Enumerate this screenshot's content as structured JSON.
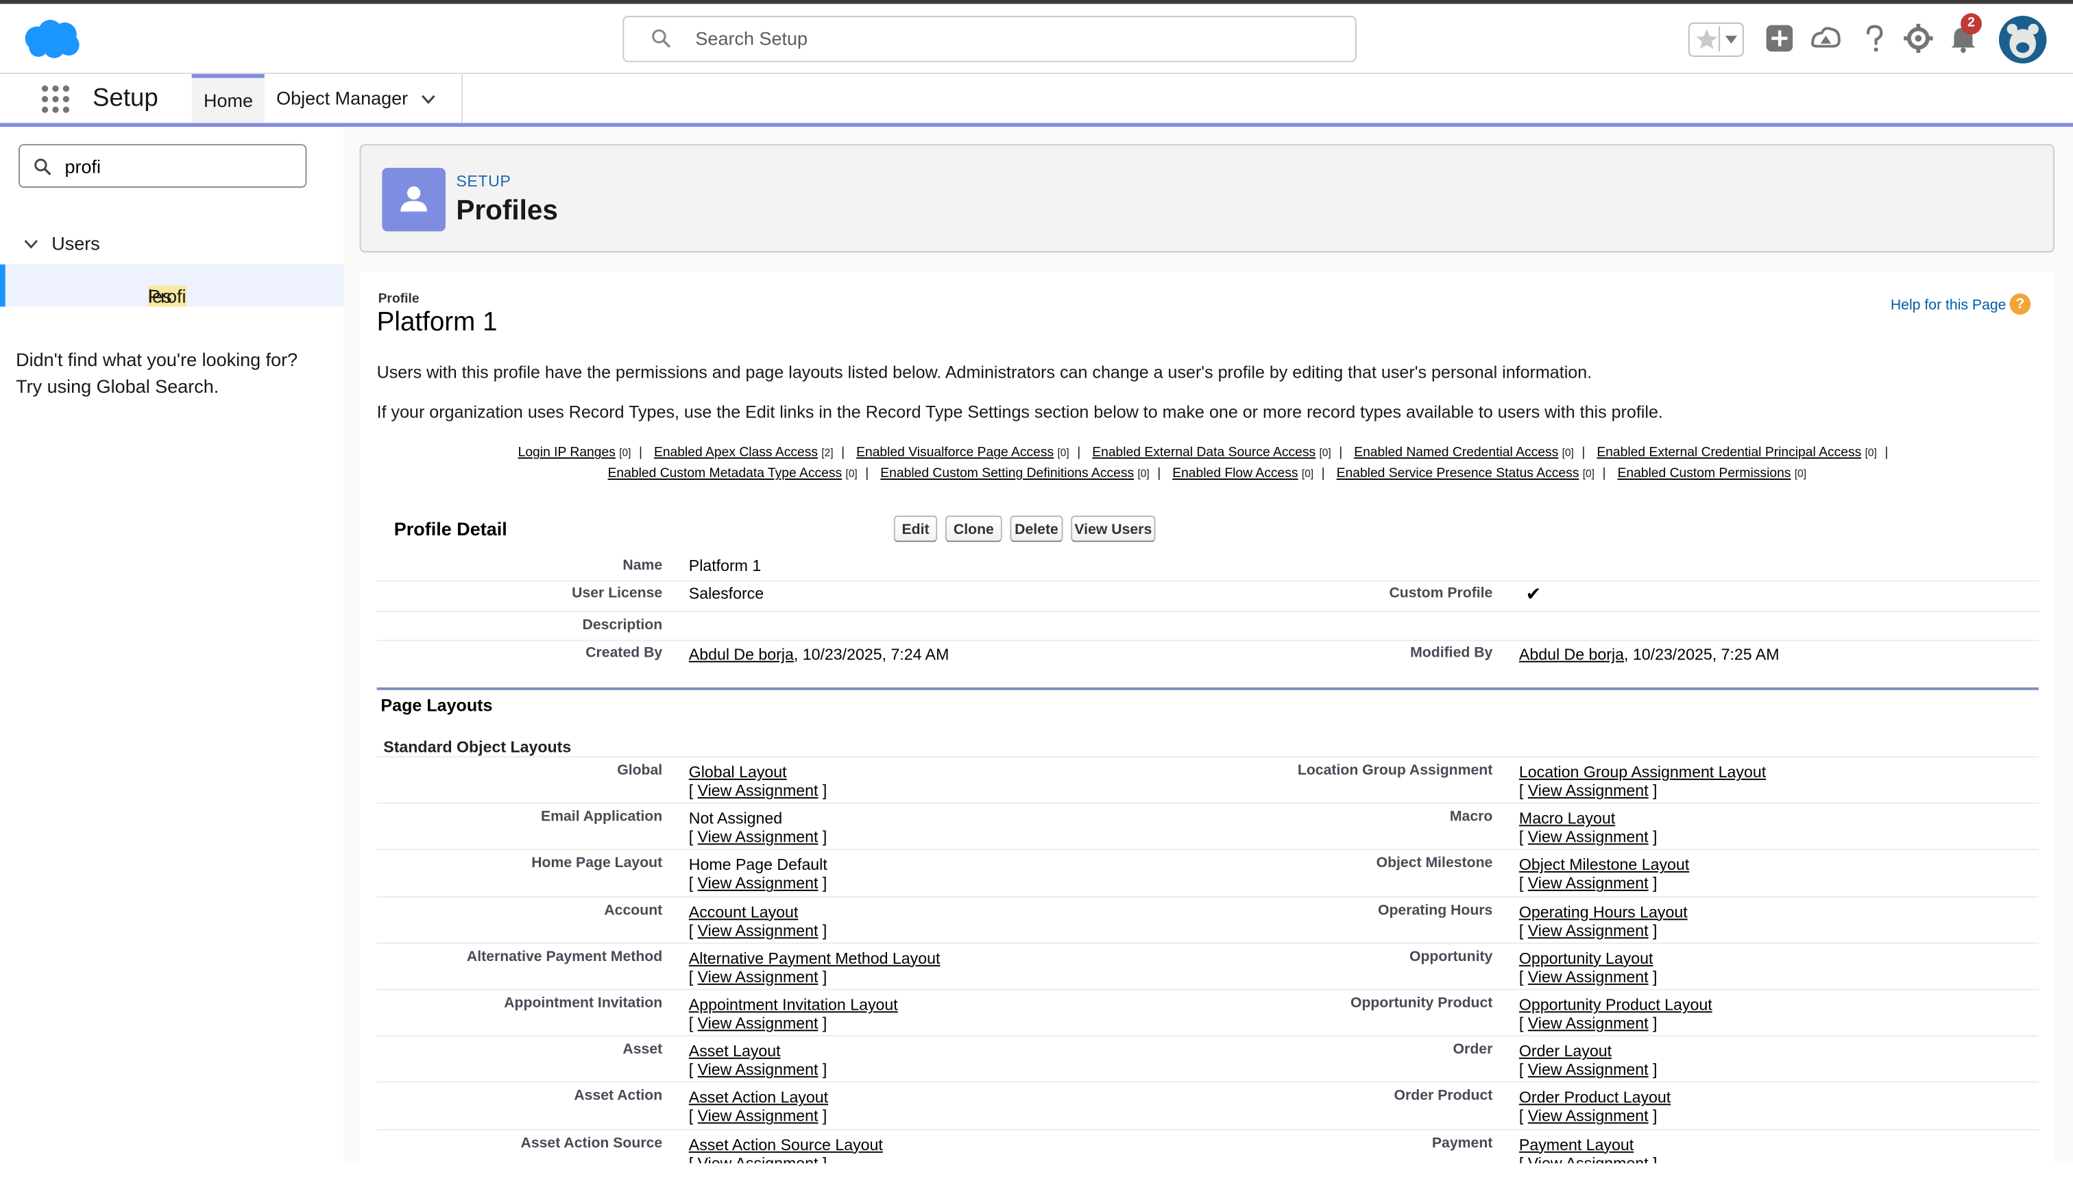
{
  "header": {
    "search_placeholder": "Search Setup",
    "notification_count": "2",
    "icons": [
      "favorites-star-icon",
      "add-icon",
      "trailhead-icon",
      "help-icon",
      "gear-icon",
      "bell-icon",
      "avatar"
    ]
  },
  "appnav": {
    "app_name": "Setup",
    "tab_home": "Home",
    "tab_object_manager": "Object Manager"
  },
  "sidebar": {
    "quickfind_value": "profi",
    "tree_parent": "Users",
    "tree_child_highlight": "Profi",
    "tree_child_rest": "les",
    "notfound_line1": "Didn't find what you're looking for?",
    "notfound_line2": "Try using Global Search."
  },
  "page_header": {
    "crumb": "SETUP",
    "title": "Profiles"
  },
  "profile": {
    "type_label": "Profile",
    "name": "Platform 1",
    "help_link": "Help for this Page",
    "help_icon": "?",
    "desc1": "Users with this profile have the permissions and page layouts listed below. Administrators can change a user's profile by editing that user's personal information.",
    "desc2": "If your organization uses Record Types, use the Edit links in the Record Type Settings section below to make one or more record types available to users with this profile.",
    "links_row1": [
      {
        "label": "Login IP Ranges",
        "count": "[0]"
      },
      {
        "label": "Enabled Apex Class Access",
        "count": "[2]"
      },
      {
        "label": "Enabled Visualforce Page Access",
        "count": "[0]"
      },
      {
        "label": "Enabled External Data Source Access",
        "count": "[0]"
      },
      {
        "label": "Enabled Named Credential Access",
        "count": "[0]"
      },
      {
        "label": "Enabled External Credential Principal Access",
        "count": "[0]"
      }
    ],
    "links_row2": [
      {
        "label": "Enabled Custom Metadata Type Access",
        "count": "[0]"
      },
      {
        "label": "Enabled Custom Setting Definitions Access",
        "count": "[0]"
      },
      {
        "label": "Enabled Flow Access",
        "count": "[0]"
      },
      {
        "label": "Enabled Service Presence Status Access",
        "count": "[0]"
      },
      {
        "label": "Enabled Custom Permissions",
        "count": "[0]"
      }
    ],
    "detail_title": "Profile Detail",
    "buttons": {
      "edit": "Edit",
      "clone": "Clone",
      "delete": "Delete",
      "view_users": "View Users"
    },
    "fields": {
      "name_label": "Name",
      "name_value": "Platform 1",
      "license_label": "User License",
      "license_value": "Salesforce",
      "custom_label": "Custom Profile",
      "custom_value": "✔",
      "description_label": "Description",
      "created_label": "Created By",
      "created_user": "Abdul De borja",
      "created_date": ", 10/23/2025, 7:24 AM",
      "modified_label": "Modified By",
      "modified_user": "Abdul De borja",
      "modified_date": ", 10/23/2025, 7:25 AM"
    }
  },
  "layouts": {
    "section_title": "Page Layouts",
    "subhead": "Standard Object Layouts",
    "view_prefix": "[ ",
    "view_label": "View Assignment",
    "view_suffix": " ]",
    "rows": [
      {
        "l_label": "Global",
        "l_value": "Global Layout",
        "l_link": true,
        "r_label": "Location Group Assignment",
        "r_value": "Location Group Assignment Layout"
      },
      {
        "l_label": "Email Application",
        "l_value": "Not Assigned",
        "l_link": false,
        "r_label": "Macro",
        "r_value": "Macro Layout"
      },
      {
        "l_label": "Home Page Layout",
        "l_value": "Home Page Default",
        "l_link": false,
        "r_label": "Object Milestone",
        "r_value": "Object Milestone Layout"
      },
      {
        "l_label": "Account",
        "l_value": "Account Layout",
        "l_link": true,
        "r_label": "Operating Hours",
        "r_value": "Operating Hours Layout"
      },
      {
        "l_label": "Alternative Payment Method",
        "l_value": "Alternative Payment Method Layout",
        "l_link": true,
        "r_label": "Opportunity",
        "r_value": "Opportunity Layout"
      },
      {
        "l_label": "Appointment Invitation",
        "l_value": "Appointment Invitation Layout",
        "l_link": true,
        "r_label": "Opportunity Product",
        "r_value": "Opportunity Product Layout"
      },
      {
        "l_label": "Asset",
        "l_value": "Asset Layout",
        "l_link": true,
        "r_label": "Order",
        "r_value": "Order Layout"
      },
      {
        "l_label": "Asset Action",
        "l_value": "Asset Action Layout",
        "l_link": true,
        "r_label": "Order Product",
        "r_value": "Order Product Layout"
      },
      {
        "l_label": "Asset Action Source",
        "l_value": "Asset Action Source Layout",
        "l_link": true,
        "r_label": "Payment",
        "r_value": "Payment Layout"
      }
    ]
  }
}
